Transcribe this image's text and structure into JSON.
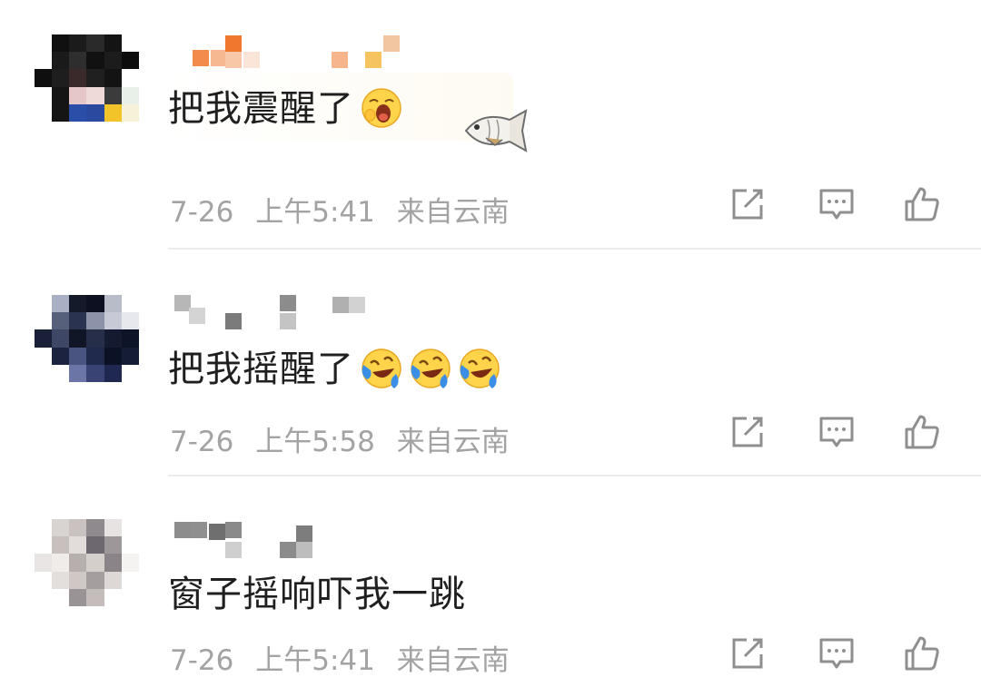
{
  "comments": [
    {
      "text": "把我震醒了",
      "emojis": [
        "yawn-emoji"
      ],
      "has_sticker": true,
      "date": "7-26",
      "time": "上午5:41",
      "location": "来自云南"
    },
    {
      "text": "把我摇醒了",
      "emojis": [
        "laugh-cry-emoji",
        "laugh-cry-emoji",
        "laugh-cry-emoji"
      ],
      "has_sticker": false,
      "date": "7-26",
      "time": "上午5:58",
      "location": "来自云南"
    },
    {
      "text": "窗子摇响吓我一跳",
      "emojis": [],
      "has_sticker": false,
      "date": "7-26",
      "time": "上午5:41",
      "location": "来自云南"
    }
  ],
  "icons": {
    "share": "share-icon",
    "reply": "comment-icon",
    "like": "thumbs-up-icon"
  },
  "colors": {
    "meta_text": "#a3a3a3",
    "icon_stroke": "#8f8f8f",
    "divider": "#ececec",
    "emoji_yellow": "#ffd44a",
    "tear_blue": "#3a8ee6"
  }
}
